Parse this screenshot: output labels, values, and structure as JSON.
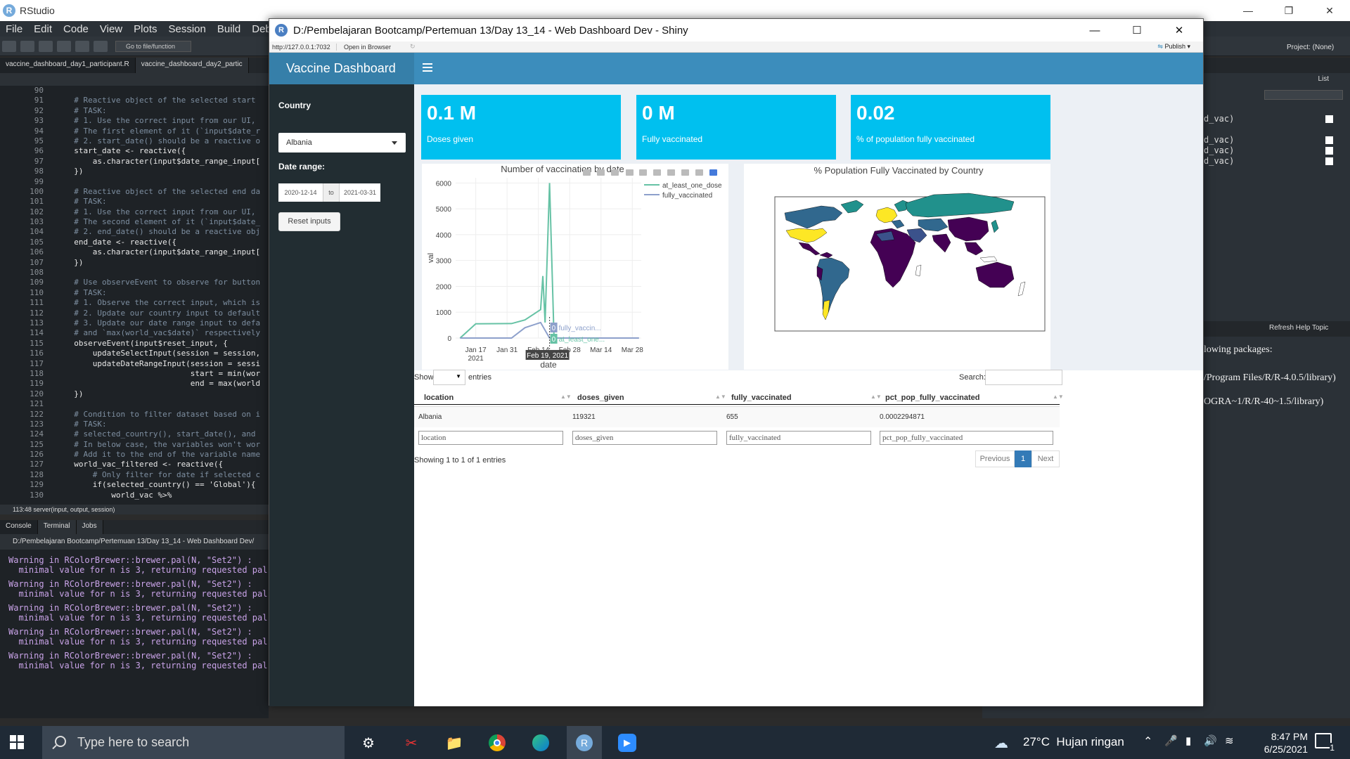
{
  "rstudio": {
    "title": "RStudio",
    "menu": [
      "File",
      "Edit",
      "Code",
      "View",
      "Plots",
      "Session",
      "Build",
      "Debu"
    ],
    "goto_placeholder": "Go to file/function",
    "project": "Project: (None)",
    "editor_tabs": [
      "vaccine_dashboard_day1_participant.R",
      "vaccine_dashboard_day2_partic"
    ],
    "code_lines": [
      {
        "n": "90",
        "t": ""
      },
      {
        "n": "91",
        "t": "  # Reactive object of the selected start",
        "c": true
      },
      {
        "n": "92",
        "t": "  # TASK:",
        "c": true
      },
      {
        "n": "93",
        "t": "  # 1. Use the correct input from our UI,",
        "c": true
      },
      {
        "n": "94",
        "t": "  # The first element of it (`input$date_r",
        "c": true
      },
      {
        "n": "95",
        "t": "  # 2. start_date() should be a reactive o",
        "c": true
      },
      {
        "n": "96",
        "t": "  start_date <- reactive({"
      },
      {
        "n": "97",
        "t": "      as.character(input$date_range_input["
      },
      {
        "n": "98",
        "t": "  })"
      },
      {
        "n": "99",
        "t": ""
      },
      {
        "n": "100",
        "t": "  # Reactive object of the selected end da",
        "c": true
      },
      {
        "n": "101",
        "t": "  # TASK:",
        "c": true
      },
      {
        "n": "102",
        "t": "  # 1. Use the correct input from our UI,",
        "c": true
      },
      {
        "n": "103",
        "t": "  # The second element of it (`input$date_",
        "c": true
      },
      {
        "n": "104",
        "t": "  # 2. end_date() should be a reactive obj",
        "c": true
      },
      {
        "n": "105",
        "t": "  end_date <- reactive({"
      },
      {
        "n": "106",
        "t": "      as.character(input$date_range_input["
      },
      {
        "n": "107",
        "t": "  })"
      },
      {
        "n": "108",
        "t": ""
      },
      {
        "n": "109",
        "t": "  # Use observeEvent to observe for button",
        "c": true
      },
      {
        "n": "110",
        "t": "  # TASK:",
        "c": true
      },
      {
        "n": "111",
        "t": "  # 1. Observe the correct input, which is",
        "c": true
      },
      {
        "n": "112",
        "t": "  # 2. Update our country input to default",
        "c": true
      },
      {
        "n": "113",
        "t": "  # 3. Update our date range input to defa",
        "c": true
      },
      {
        "n": "114",
        "t": "  # and `max(world_vac$date)` respectively",
        "c": true
      },
      {
        "n": "115",
        "t": "  observeEvent(input$reset_input, {"
      },
      {
        "n": "116",
        "t": "      updateSelectInput(session = session,"
      },
      {
        "n": "117",
        "t": "      updateDateRangeInput(session = sessi"
      },
      {
        "n": "118",
        "t": "                           start = min(wor"
      },
      {
        "n": "119",
        "t": "                           end = max(world"
      },
      {
        "n": "120",
        "t": "  })"
      },
      {
        "n": "121",
        "t": ""
      },
      {
        "n": "122",
        "t": "  # Condition to filter dataset based on i",
        "c": true
      },
      {
        "n": "123",
        "t": "  # TASK:",
        "c": true
      },
      {
        "n": "124",
        "t": "  # selected_country(), start_date(), and",
        "c": true
      },
      {
        "n": "125",
        "t": "  # In below case, the variables won't wor",
        "c": true
      },
      {
        "n": "126",
        "t": "  # Add it to the end of the variable name",
        "c": true
      },
      {
        "n": "127",
        "t": "  world_vac_filtered <- reactive({"
      },
      {
        "n": "128",
        "t": "      # Only filter for date if selected c",
        "c": true
      },
      {
        "n": "129",
        "t": "      if(selected_country() == 'Global'){"
      },
      {
        "n": "130",
        "t": "          world_vac %>%"
      }
    ],
    "editor_status": "113:48    server(input, output, session)",
    "console_tabs": [
      "Console",
      "Terminal",
      "Jobs"
    ],
    "console_path": "D:/Pembelajaran Bootcamp/Pertemuan 13/Day 13_14 - Web Dashboard Dev/",
    "console_warning_line1": "Warning in RColorBrewer::brewer.pal(N, \"Set2\") :",
    "console_warning_line2": "  minimal value for n is 3, returning requested pal",
    "env_rows": [
      "d_vac)",
      "d_vac)",
      "d_vac)",
      "d_vac)"
    ],
    "list_label": "List",
    "refresh_help": "Refresh Help Topic",
    "help_text": [
      "lowing packages:",
      "/Program Files/R/R-4.0.5/library)",
      "OGRA~1/R/R-40~1.5/library)"
    ]
  },
  "shiny_window": {
    "title": "D:/Pembelajaran Bootcamp/Pertemuan 13/Day 13_14 - Web Dashboard Dev - Shiny",
    "url": "http://127.0.0.1:7032",
    "open_in_browser": "Open in Browser",
    "publish": "Publish"
  },
  "dashboard": {
    "brand": "Vaccine Dashboard",
    "country_label": "Country",
    "country_value": "Albania",
    "date_range_label": "Date range:",
    "date_start": "2020-12-14",
    "date_to": "to",
    "date_end": "2021-03-31",
    "reset_label": "Reset inputs",
    "value_boxes": [
      {
        "value": "0.1 M",
        "label": "Doses given"
      },
      {
        "value": "0 M",
        "label": "Fully vaccinated"
      },
      {
        "value": "0.02",
        "label": "% of population fully vaccinated"
      }
    ],
    "map_title": "% Population Fully Vaccinated by Country",
    "table": {
      "show_label": "Show",
      "entries_label": "entries",
      "search_label": "Search:",
      "columns": [
        "location",
        "doses_given",
        "fully_vaccinated",
        "pct_pop_fully_vaccinated"
      ],
      "rows": [
        [
          "Albania",
          "119321",
          "655",
          "0.0002294871"
        ]
      ],
      "info": "Showing 1 to 1 of 1 entries",
      "prev": "Previous",
      "page": "1",
      "next": "Next"
    }
  },
  "chart_data": {
    "type": "line",
    "title": "Number of vaccination by date",
    "xlabel": "date",
    "ylabel": "val",
    "ylim": [
      0,
      6200
    ],
    "yticks": [
      "0",
      "1000",
      "2000",
      "3000",
      "4000",
      "5000",
      "6000"
    ],
    "xticks": [
      "Jan 17\n2021",
      "Jan 31",
      "Feb 14",
      "Feb 28",
      "Mar 14",
      "Mar 28"
    ],
    "xlim": [
      "2021-01-08",
      "2021-04-01"
    ],
    "series": [
      {
        "name": "at_least_one_dose",
        "color": "#66c2a5",
        "x": [
          "2021-01-10",
          "2021-01-17",
          "2021-02-02",
          "2021-02-08",
          "2021-02-15",
          "2021-02-16",
          "2021-02-17",
          "2021-02-19",
          "2021-02-21",
          "2021-02-22"
        ],
        "y": [
          0,
          550,
          560,
          700,
          1100,
          2400,
          600,
          6000,
          0,
          0
        ]
      },
      {
        "name": "fully_vaccinated",
        "color": "#8da0cb",
        "x": [
          "2021-01-10",
          "2021-02-02",
          "2021-02-08",
          "2021-02-15",
          "2021-02-19",
          "2021-02-22",
          "2021-03-31"
        ],
        "y": [
          0,
          0,
          400,
          600,
          0,
          0,
          0
        ]
      }
    ],
    "hover": {
      "x_label": "Feb 19, 2021",
      "items": [
        {
          "value": "0",
          "label": "fully_vaccin..."
        },
        {
          "value": "0",
          "label": "at_least_one..."
        }
      ]
    }
  },
  "taskbar": {
    "search_placeholder": "Type here to search",
    "weather": "27°C  Hujan ringan",
    "time": "8:47 PM",
    "date": "6/25/2021",
    "notifications": "1"
  }
}
